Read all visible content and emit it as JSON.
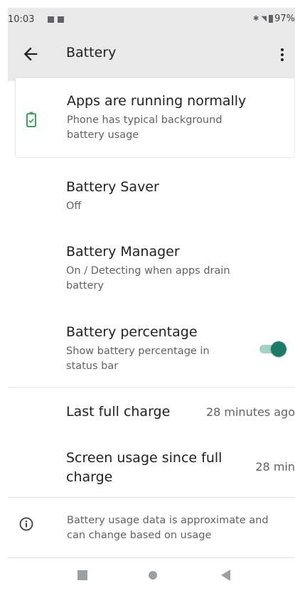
{
  "status_bar": {
    "time": "10:03",
    "icons": [
      "bluetooth-icon",
      "wifi-icon"
    ],
    "battery_percent": "97%"
  },
  "app_bar": {
    "title": "Battery",
    "back_icon": "back-arrow-icon",
    "menu_icon": "more-vert-icon"
  },
  "status_card": {
    "title": "Apps are running normally",
    "subtitle": "Phone has typical background battery usage",
    "icon": "battery-check-icon",
    "icon_color": "#34a853"
  },
  "settings": [
    {
      "title": "Battery Saver",
      "subtitle": "Off"
    },
    {
      "title": "Battery Manager",
      "subtitle": "On / Detecting when apps drain battery"
    },
    {
      "title": "Battery percentage",
      "subtitle": "Show battery percentage in status bar",
      "toggle_on": true,
      "toggle_color": "#1b7c69"
    }
  ],
  "stats": [
    {
      "title": "Last full charge",
      "value": "28 minutes ago"
    },
    {
      "title": "Screen usage since full charge",
      "value": "28 min"
    }
  ],
  "footer_note": {
    "icon": "info-icon",
    "text": "Battery usage data is approximate and can change based on usage"
  },
  "nav_bar": {
    "buttons": [
      "recents-square-icon",
      "home-circle-icon",
      "back-triangle-icon"
    ]
  }
}
